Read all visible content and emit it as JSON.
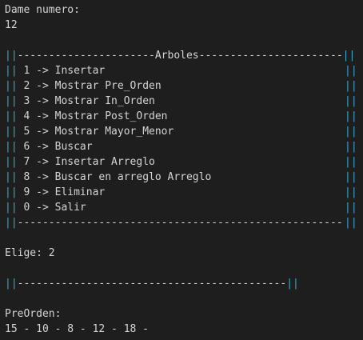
{
  "terminal": {
    "prompt_number": "Dame numero:",
    "input_number": "12",
    "menu": {
      "border_left": "||",
      "border_right": "||",
      "top_left_dashes": "----------------------",
      "title": "Arboles",
      "top_right_dashes": "-----------------------",
      "items": [
        " 1 -> Insertar",
        " 2 -> Mostrar Pre_Orden",
        " 3 -> Mostrar In_Orden",
        " 4 -> Mostrar Post_Orden",
        " 5 -> Mostrar Mayor_Menor",
        " 6 -> Buscar",
        " 7 -> Insertar Arreglo",
        " 8 -> Buscar en arreglo Arreglo",
        " 9 -> Eliminar",
        " 0 -> Salir"
      ],
      "bottom_dashes": "----------------------------------------------------"
    },
    "choice": "Elige: 2",
    "separator": {
      "border": "||",
      "dashes": "-------------------------------------------"
    },
    "result_label": "PreOrden:",
    "result_values": "15 - 10 - 8 - 12 - 18 -",
    "colors": {
      "background": "#1e1e1e",
      "text": "#d4d4d4",
      "border": "#3aa7c9"
    }
  }
}
